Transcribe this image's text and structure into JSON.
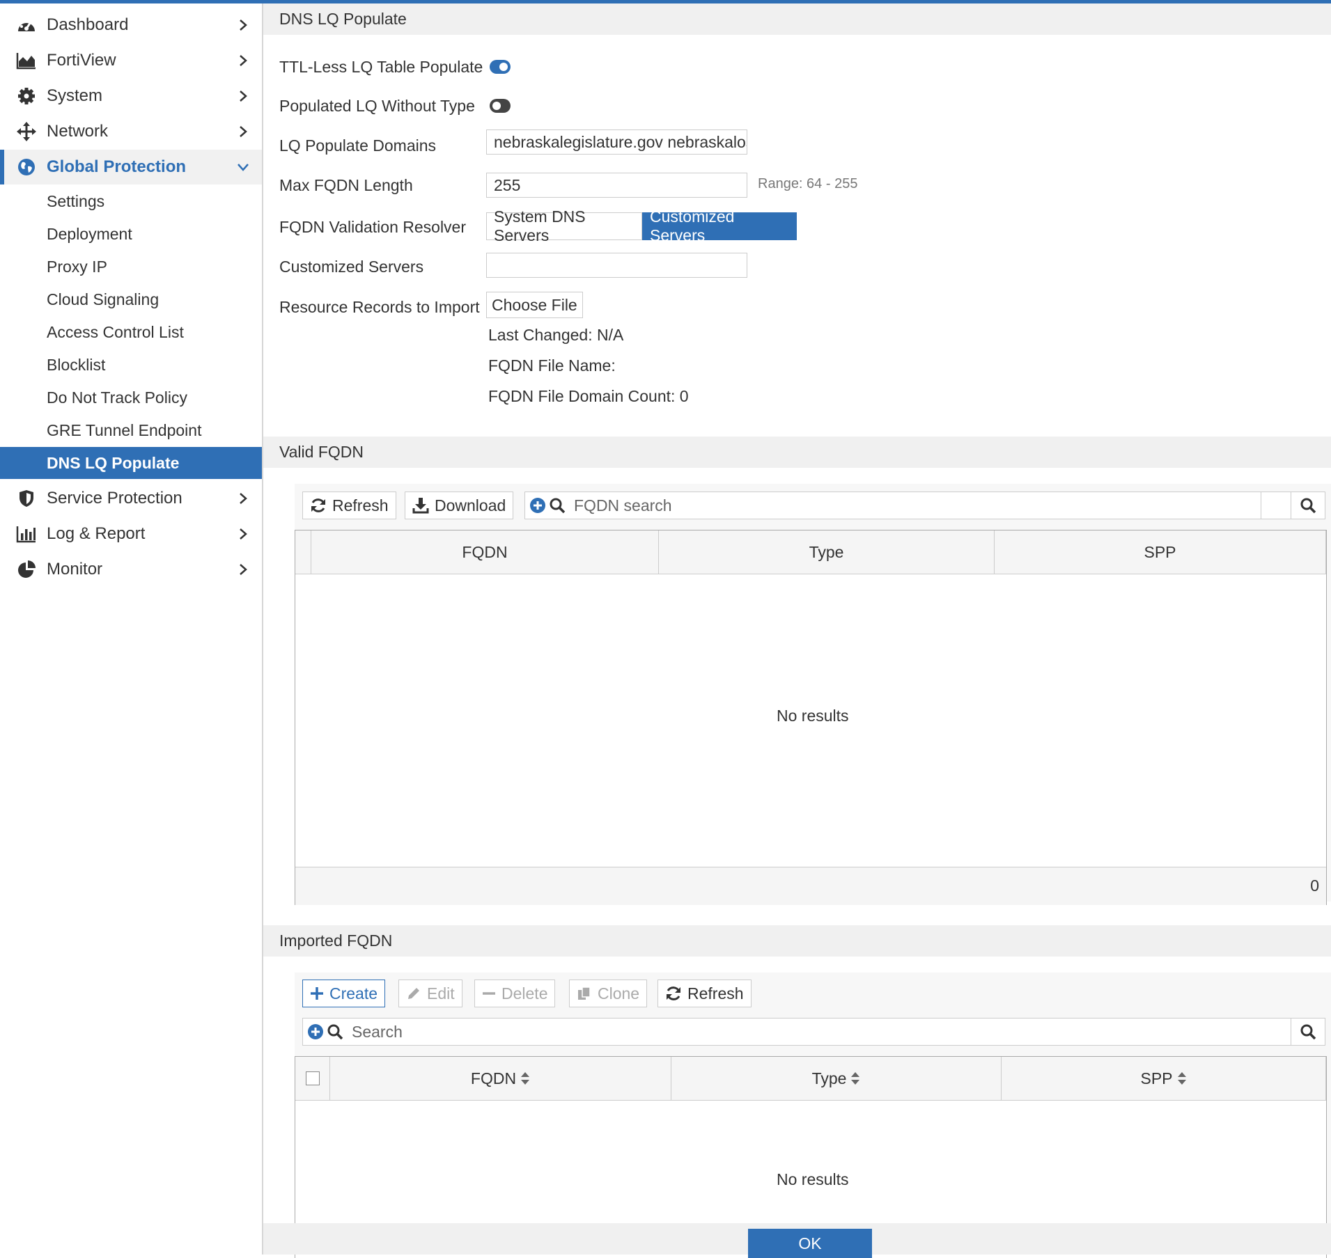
{
  "colors": {
    "accent": "#2f6fb5",
    "sidebar_active_bg": "#2f6fb5",
    "section_bg": "#f0f0f0"
  },
  "sidebar": {
    "items": [
      {
        "label": "Dashboard",
        "icon": "dashboard-gauge-icon"
      },
      {
        "label": "FortiView",
        "icon": "area-chart-icon"
      },
      {
        "label": "System",
        "icon": "gear-icon"
      },
      {
        "label": "Network",
        "icon": "move-arrows-icon"
      },
      {
        "label": "Global Protection",
        "icon": "globe-icon",
        "expanded": true
      },
      {
        "label": "Service Protection",
        "icon": "shield-icon"
      },
      {
        "label": "Log & Report",
        "icon": "bar-chart-icon"
      },
      {
        "label": "Monitor",
        "icon": "pie-chart-icon"
      }
    ],
    "subitems": [
      {
        "label": "Settings"
      },
      {
        "label": "Deployment"
      },
      {
        "label": "Proxy IP"
      },
      {
        "label": "Cloud Signaling"
      },
      {
        "label": "Access Control List"
      },
      {
        "label": "Blocklist"
      },
      {
        "label": "Do Not Track Policy"
      },
      {
        "label": "GRE Tunnel Endpoint"
      },
      {
        "label": "DNS LQ Populate",
        "active": true
      }
    ]
  },
  "page": {
    "title": "DNS LQ Populate",
    "form": {
      "ttl_less_label": "TTL-Less LQ Table Populate",
      "ttl_less_enabled": true,
      "without_type_label": "Populated LQ Without Type",
      "without_type_enabled": false,
      "domains_label": "LQ Populate Domains",
      "domains_value": "nebraskalegislature.gov nebraskalos",
      "max_len_label": "Max FQDN Length",
      "max_len_value": "255",
      "max_len_hint": "Range: 64 - 255",
      "resolver_label": "FQDN Validation Resolver",
      "resolver_options": [
        "System DNS Servers",
        "Customized Servers"
      ],
      "resolver_selected": "Customized Servers",
      "custom_servers_label": "Customized Servers",
      "custom_servers_value": "",
      "records_label": "Resource Records to Import",
      "choose_file_label": "Choose File",
      "last_changed": "Last Changed:  N/A",
      "file_name": "FQDN File Name:",
      "domain_count": "FQDN File Domain Count: 0"
    },
    "valid": {
      "title": "Valid FQDN",
      "refresh_label": "Refresh",
      "download_label": "Download",
      "search_placeholder": "FQDN search",
      "columns": [
        "FQDN",
        "Type",
        "SPP"
      ],
      "empty_text": "No results",
      "count": "0"
    },
    "imported": {
      "title": "Imported FQDN",
      "create_label": "Create",
      "edit_label": "Edit",
      "delete_label": "Delete",
      "clone_label": "Clone",
      "refresh_label": "Refresh",
      "search_placeholder": "Search",
      "columns": [
        "FQDN",
        "Type",
        "SPP"
      ],
      "empty_text": "No results"
    },
    "ok_label": "OK"
  }
}
